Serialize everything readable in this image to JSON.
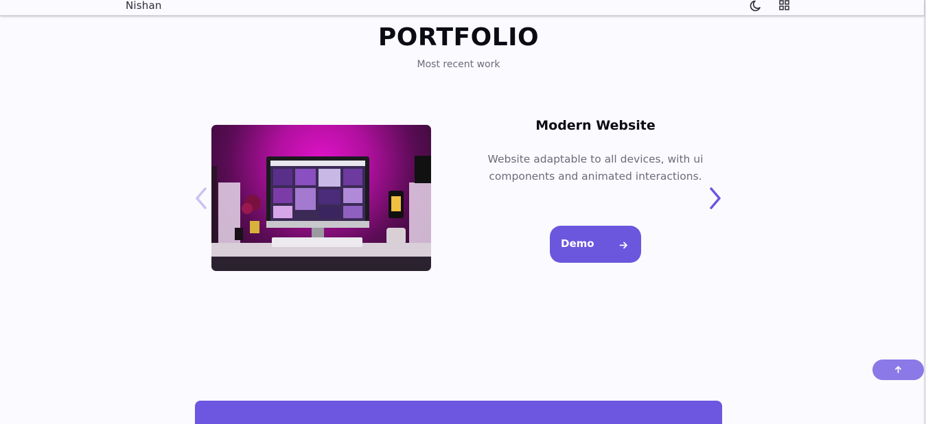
{
  "header": {
    "logo": "Nishan",
    "theme_icon": "moon-icon",
    "menu_icon": "grid-icon"
  },
  "portfolio": {
    "title": "PORTFOLIO",
    "subtitle": "Most recent work",
    "project": {
      "title": "Modern Website",
      "description": "Website adaptable to all devices, with ui components and animated interactions.",
      "button_label": "Demo",
      "button_icon": "arrow-right-icon",
      "image": "desktop-setup-image"
    },
    "prev_icon": "chevron-left-icon",
    "next_icon": "chevron-right-icon"
  },
  "scrollup_icon": "arrow-up-icon",
  "colors": {
    "accent": "#6b56de",
    "accent_light": "#8a79e6",
    "background": "#fbfaff",
    "text_title": "#0b0b14",
    "text_muted": "#6b6b78"
  }
}
